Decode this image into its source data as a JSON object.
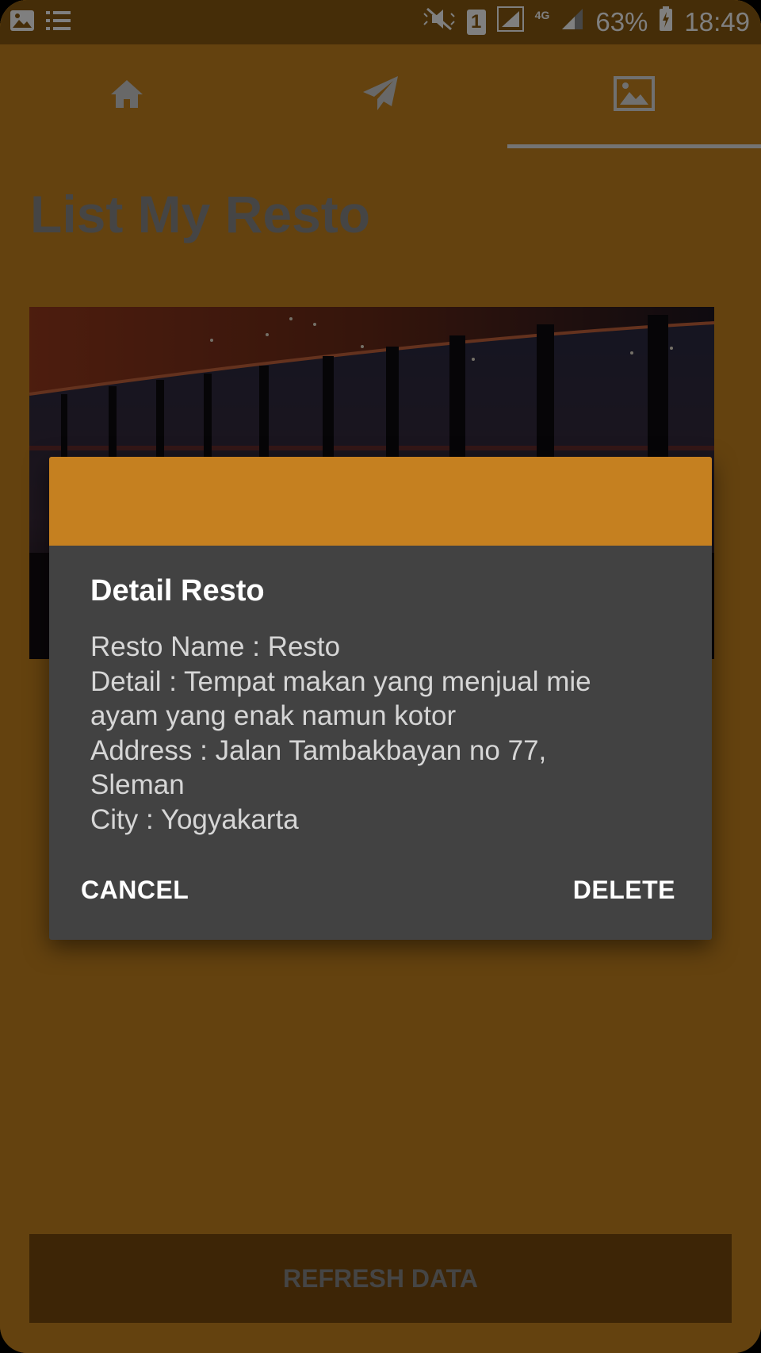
{
  "status_bar": {
    "battery_percent": "63%",
    "time": "18:49",
    "sim_slot": "1",
    "network_type": "4G",
    "icons": [
      "gallery-icon",
      "notification-list-icon",
      "mute-icon",
      "sim-icon",
      "signal-icon",
      "signal-icon",
      "battery-charging-icon"
    ]
  },
  "tabs": [
    {
      "icon": "home-icon",
      "selected": false
    },
    {
      "icon": "send-icon",
      "selected": false
    },
    {
      "icon": "image-icon",
      "selected": true
    }
  ],
  "page": {
    "title": "List My Resto",
    "refresh_button": "REFRESH DATA"
  },
  "dialog": {
    "title": "Detail Resto",
    "lines": [
      "Resto Name : Resto",
      "Detail : Tempat makan yang menjual mie",
      "ayam yang enak namun kotor",
      "Address : Jalan Tambakbayan no 77,",
      "Sleman",
      "City : Yogyakarta"
    ],
    "cancel_label": "CANCEL",
    "delete_label": "DELETE"
  },
  "colors": {
    "accent": "#C58020",
    "dialog_bg": "#424242"
  }
}
